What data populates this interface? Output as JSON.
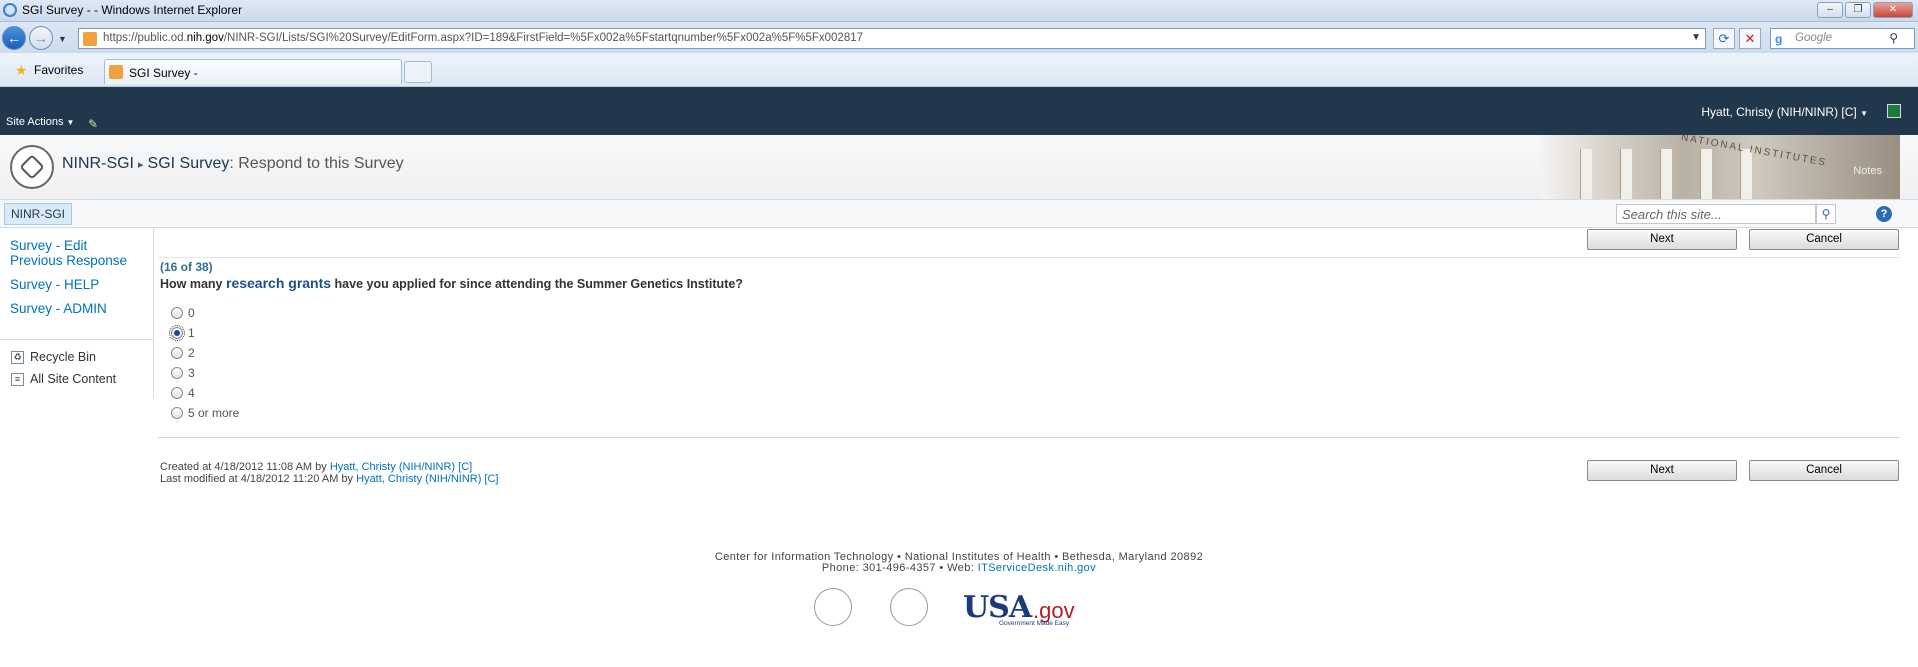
{
  "browser": {
    "window_title": "SGI Survey - - Windows Internet Explorer",
    "url_prefix": "https://public.od.",
    "url_domain": "nih.gov",
    "url_rest": "/NINR-SGI/Lists/SGI%20Survey/EditForm.aspx?ID=189&FirstField=%5Fx002a%5Fstartqnumber%5Fx002a%5F%5Fx002817",
    "search_placeholder": "Google",
    "favorites_label": "Favorites",
    "tab_label": "SGI Survey -"
  },
  "sharepoint": {
    "site_actions": "Site Actions",
    "user": "Hyatt, Christy (NIH/NINR) [C]",
    "breadcrumb_site": "NINR-SGI",
    "breadcrumb_list": "SGI Survey",
    "breadcrumb_page": ": Respond to this Survey",
    "top_nav_tab": "NINR-SGI",
    "search_placeholder": "Search this site...",
    "banner_text": "NATIONAL INSTITUTES",
    "banner_notes": "Notes"
  },
  "left_nav": {
    "links": [
      "Survey - Edit",
      "Previous Response",
      "Survey - HELP",
      "Survey - ADMIN"
    ],
    "recycle_bin": "Recycle Bin",
    "all_site_content": "All Site Content"
  },
  "survey": {
    "progress": "(16 of 38)",
    "question_before": "How many ",
    "question_highlight": "research grants",
    "question_after": " have you applied for since attending the Summer Genetics Institute?",
    "options": [
      "0",
      "1",
      "2",
      "3",
      "4",
      "5 or more"
    ],
    "selected_option": "1",
    "next_label": "Next",
    "cancel_label": "Cancel"
  },
  "meta": {
    "created_prefix": "Created at 4/18/2012 11:08 AM by ",
    "created_by": "Hyatt, Christy (NIH/NINR) [C]",
    "modified_prefix": "Last modified at 4/18/2012 11:20 AM by ",
    "modified_by": "Hyatt, Christy (NIH/NINR) [C]"
  },
  "footer": {
    "line1": "Center for Information Technology • National Institutes of Health • Bethesda, Maryland 20892",
    "line2_prefix": "Phone: 301-496-4357 • Web: ",
    "line2_link": "ITServiceDesk.nih.gov",
    "usa": "USA",
    "gov": ".gov",
    "usa_tagline": "Government Made Easy"
  },
  "colors": {
    "sp_topbar": "#21374c",
    "link": "#0072bc",
    "progress": "#31708f",
    "usagov_red": "#b0202a",
    "usagov_blue": "#1c3a7a"
  },
  "icons": [
    "ie-logo-icon",
    "back-arrow-icon",
    "forward-arrow-icon",
    "favicon-icon",
    "refresh-icon",
    "stop-icon",
    "search-icon",
    "favorites-star-icon",
    "edit-page-icon",
    "excel-icon",
    "nih-seal-icon",
    "help-icon",
    "recycle-bin-icon",
    "site-content-icon",
    "hhs-seal-icon"
  ]
}
